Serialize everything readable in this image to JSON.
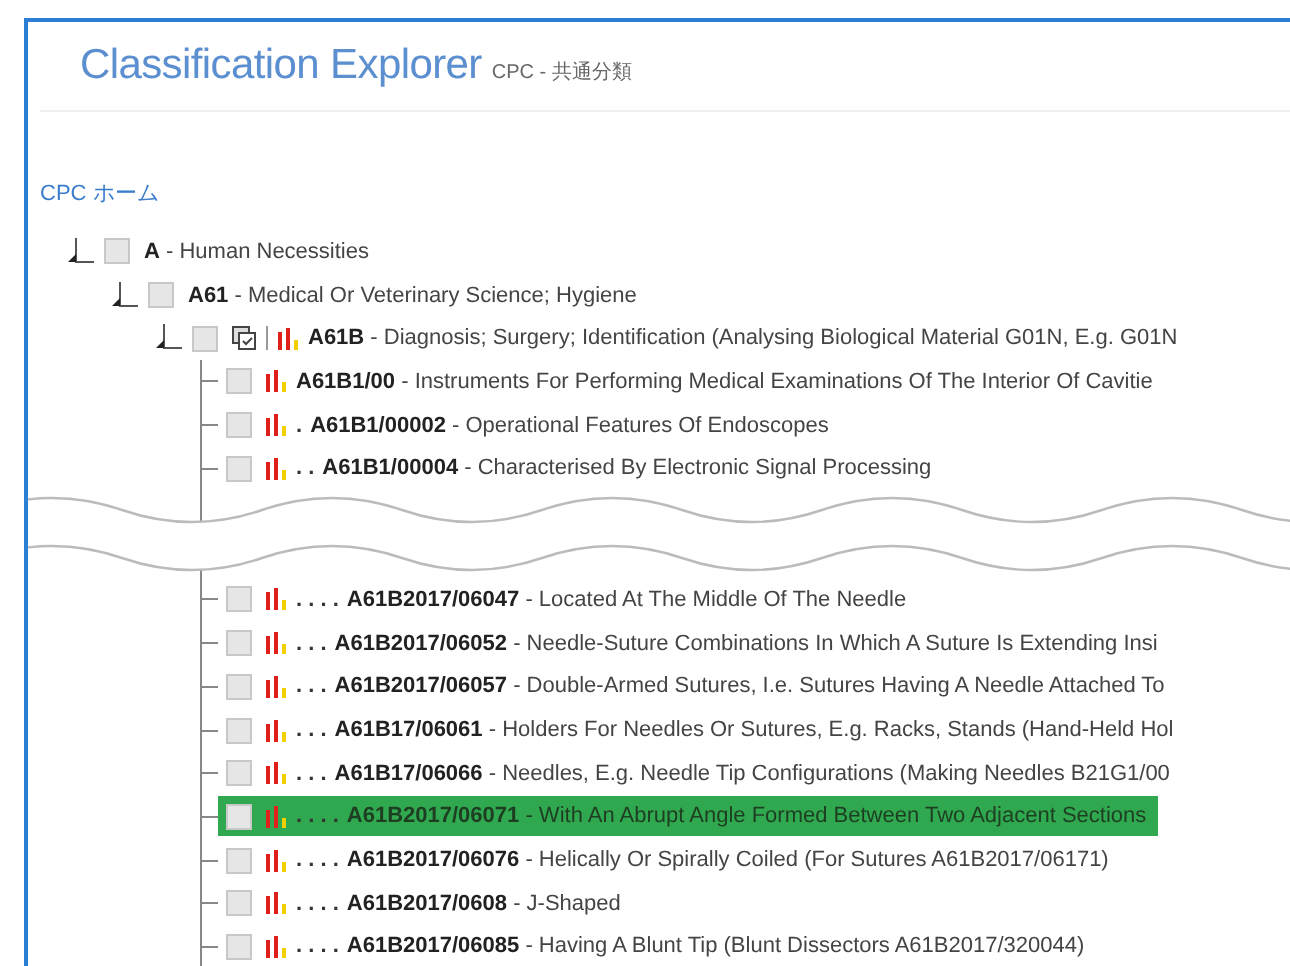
{
  "header": {
    "title": "Classification Explorer",
    "subtitle": "CPC - 共通分類"
  },
  "home_link": "CPC ホーム",
  "tree": [
    {
      "kind": "section",
      "label": "**A** - Human Necessities",
      "checked": false,
      "expanded": true,
      "children": [
        {
          "kind": "section",
          "label": "**A61** - Medical Or Veterinary Science; Hygiene",
          "checked": false,
          "expanded": true,
          "children": [
            {
              "kind": "group",
              "label": "**A61B** - Diagnosis; Surgery; Identification (Analysing Biological Material G01N, E.g. G01N",
              "checked": false,
              "expanded": true,
              "children": [
                {
                  "kind": "entry",
                  "label": "**A61B1/00** - Instruments For Performing Medical Examinations Of The Interior Of Cavitie",
                  "checked": false,
                  "selected": false
                },
                {
                  "kind": "entry",
                  "dots": ".",
                  "label": "**A61B1/00002** - Operational Features Of Endoscopes",
                  "checked": false,
                  "selected": false
                },
                {
                  "kind": "entry",
                  "dots": ". .",
                  "label": "**A61B1/00004** - Characterised By Electronic Signal Processing",
                  "checked": false,
                  "selected": false
                },
                {
                  "kind": "tear"
                },
                {
                  "kind": "entry",
                  "dots": ". . . .",
                  "label": "**A61B2017/06047** - Located At The Middle Of The Needle",
                  "checked": false,
                  "selected": false
                },
                {
                  "kind": "entry",
                  "dots": ". . .",
                  "label": "**A61B2017/06052** - Needle-Suture Combinations In Which A Suture Is Extending Insi",
                  "checked": false,
                  "selected": false
                },
                {
                  "kind": "entry",
                  "dots": ". . .",
                  "label": "**A61B2017/06057** - Double-Armed Sutures, I.e. Sutures Having A Needle Attached To",
                  "checked": false,
                  "selected": false
                },
                {
                  "kind": "entry",
                  "dots": ". . .",
                  "label": "**A61B17/06061** - Holders For Needles Or Sutures, E.g. Racks, Stands (Hand-Held Hol",
                  "checked": false,
                  "selected": false
                },
                {
                  "kind": "entry",
                  "dots": ". . .",
                  "label": "**A61B17/06066** - Needles, E.g. Needle Tip Configurations (Making Needles B21G1/00",
                  "checked": false,
                  "selected": false
                },
                {
                  "kind": "entry",
                  "dots": ". . . .",
                  "label": "**A61B2017/06071** - With An Abrupt Angle Formed Between Two Adjacent Sections",
                  "checked": false,
                  "selected": true
                },
                {
                  "kind": "entry",
                  "dots": ". . . .",
                  "label": "**A61B2017/06076** - Helically Or Spirally Coiled (For Sutures A61B2017/06171)",
                  "checked": false,
                  "selected": false
                },
                {
                  "kind": "entry",
                  "dots": ". . . .",
                  "label": "**A61B2017/0608** - J-Shaped",
                  "checked": false,
                  "selected": false
                },
                {
                  "kind": "entry",
                  "dots": ". . . .",
                  "label": "**A61B2017/06085** - Having A Blunt Tip (Blunt Dissectors A61B2017/320044)",
                  "checked": false,
                  "selected": false
                }
              ]
            }
          ]
        }
      ]
    }
  ]
}
